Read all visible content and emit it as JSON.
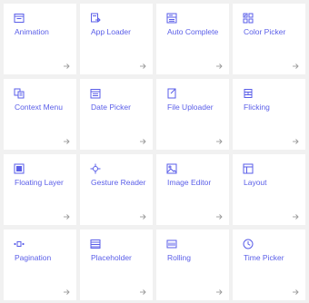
{
  "accent_color": "#5a5ee8",
  "arrow_color": "#9a9a9a",
  "cards": [
    {
      "label": "Animation",
      "icon": "animation-icon"
    },
    {
      "label": "App Loader",
      "icon": "app-loader-icon"
    },
    {
      "label": "Auto Complete",
      "icon": "auto-complete-icon"
    },
    {
      "label": "Color Picker",
      "icon": "color-picker-icon"
    },
    {
      "label": "Context Menu",
      "icon": "context-menu-icon"
    },
    {
      "label": "Date Picker",
      "icon": "date-picker-icon"
    },
    {
      "label": "File Uploader",
      "icon": "file-uploader-icon"
    },
    {
      "label": "Flicking",
      "icon": "flicking-icon"
    },
    {
      "label": "Floating Layer",
      "icon": "floating-layer-icon"
    },
    {
      "label": "Gesture Reader",
      "icon": "gesture-reader-icon"
    },
    {
      "label": "Image Editor",
      "icon": "image-editor-icon"
    },
    {
      "label": "Layout",
      "icon": "layout-icon"
    },
    {
      "label": "Pagination",
      "icon": "pagination-icon"
    },
    {
      "label": "Placeholder",
      "icon": "placeholder-icon"
    },
    {
      "label": "Rolling",
      "icon": "rolling-icon"
    },
    {
      "label": "Time Picker",
      "icon": "time-picker-icon"
    }
  ]
}
